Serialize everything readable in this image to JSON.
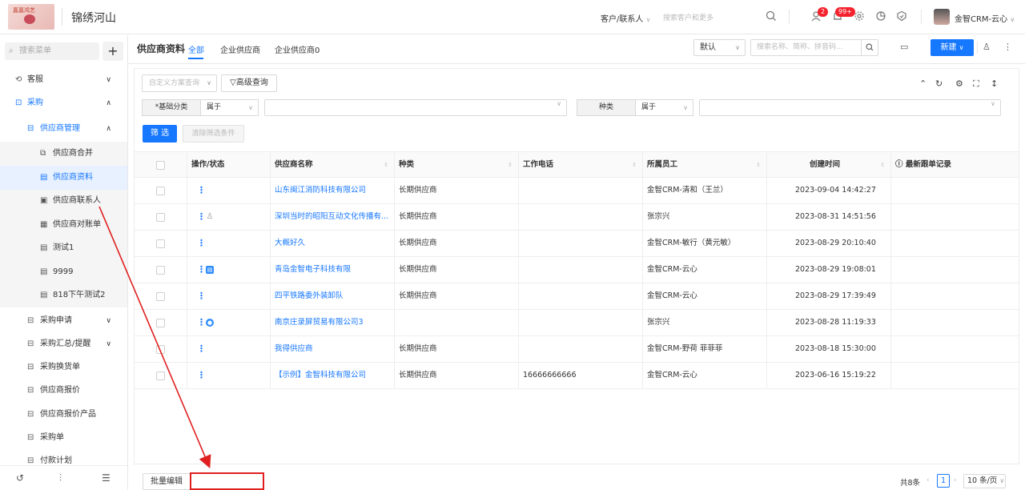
{
  "header": {
    "brand": "锦绣河山",
    "logo_text": "嘉嘉鸿艺",
    "customer_select": "客户/联系人",
    "global_search_placeholder": "搜索客户和更多",
    "badge_tasks": "2",
    "badge_notifications": "99+",
    "user_name": "金智CRM-云心",
    "icons": [
      "search-icon",
      "tasks-icon",
      "bell-icon",
      "settings-icon",
      "stats-icon",
      "shield-icon"
    ]
  },
  "sidebar": {
    "search_placeholder": "搜索菜单",
    "items": [
      {
        "label": "客服",
        "icon": "headset-icon",
        "chevron": "∨"
      },
      {
        "label": "采购",
        "icon": "cart-icon",
        "chevron": "∧"
      },
      {
        "label": "供应商管理",
        "icon": "supplier-icon",
        "chevron": "∧"
      },
      {
        "label": "供应商合并",
        "icon": "merge-icon"
      },
      {
        "label": "供应商资料",
        "icon": "doc-icon"
      },
      {
        "label": "供应商联系人",
        "icon": "contact-icon"
      },
      {
        "label": "供应商对账单",
        "icon": "statement-icon"
      },
      {
        "label": "测试1",
        "icon": "doc-icon"
      },
      {
        "label": "9999",
        "icon": "doc-icon"
      },
      {
        "label": "818下午测试2",
        "icon": "doc-icon"
      },
      {
        "label": "采购申请",
        "icon": "request-icon",
        "chevron": "∨"
      },
      {
        "label": "采购汇总/提醒",
        "icon": "summary-icon",
        "chevron": "∨"
      },
      {
        "label": "采购换货单",
        "icon": "exchange-icon"
      },
      {
        "label": "供应商报价",
        "icon": "quote-icon"
      },
      {
        "label": "供应商报价产品",
        "icon": "quote-product-icon"
      },
      {
        "label": "采购单",
        "icon": "order-icon"
      },
      {
        "label": "付款计划",
        "icon": "payment-icon"
      }
    ]
  },
  "page": {
    "title": "供应商资料",
    "tabs": [
      "全部",
      "企业供应商",
      "企业供应商0"
    ],
    "view_select": "默认",
    "keyword_placeholder": "搜索名称、简称、拼音码...",
    "new_button": "新建"
  },
  "filters": {
    "scheme_placeholder": "自定义方案查询",
    "advanced": "高级查询",
    "field1_label": "*基础分类",
    "field1_op": "属于",
    "field2_label": "种类",
    "field2_op": "属于",
    "filter_button": "筛 选",
    "clear_button": "清除筛选条件"
  },
  "table": {
    "columns": [
      "操作/状态",
      "供应商名称",
      "种类",
      "工作电话",
      "所属员工",
      "创建时间",
      "最新跟单记录"
    ],
    "rows": [
      {
        "name": "山东闽江消防科技有限公司",
        "kind": "长期供应商",
        "phone": "",
        "staff": "金智CRM-清和（王兰）",
        "created": "2023-09-04 14:42:27",
        "status": ""
      },
      {
        "name": "深圳当时的昭阳互动文化传播有...",
        "kind": "长期供应商",
        "phone": "",
        "staff": "张宗兴",
        "created": "2023-08-31 14:51:56",
        "status": "person"
      },
      {
        "name": "大概好久",
        "kind": "长期供应商",
        "phone": "",
        "staff": "金智CRM-敏行（黄元敏）",
        "created": "2023-08-29 20:10:40",
        "status": ""
      },
      {
        "name": "青岛金智电子科技有限",
        "kind": "长期供应商",
        "phone": "",
        "staff": "金智CRM-云心",
        "created": "2023-08-29 19:08:01",
        "status": "doc"
      },
      {
        "name": "四平铁路委外装卸队",
        "kind": "长期供应商",
        "phone": "",
        "staff": "金智CRM-云心",
        "created": "2023-08-29 17:39:49",
        "status": ""
      },
      {
        "name": "南京庄录屏贸易有限公司3",
        "kind": "",
        "phone": "",
        "staff": "张宗兴",
        "created": "2023-08-28 11:19:33",
        "status": "circle"
      },
      {
        "name": "我得供应商",
        "kind": "长期供应商",
        "phone": "",
        "staff": "金智CRM-野荷 菲菲菲",
        "created": "2023-08-18 15:30:00",
        "status": ""
      },
      {
        "name": "【示例】金智科技有限公司",
        "kind": "长期供应商",
        "phone": "16666666666",
        "staff": "金智CRM-云心",
        "created": "2023-06-16 15:19:22",
        "status": ""
      }
    ]
  },
  "footer": {
    "batch_edit": "批量编辑",
    "total": "共8条",
    "page": "1",
    "page_size": "10 条/页"
  },
  "colors": {
    "accent": "#1677ff",
    "annotation": "#e02020"
  }
}
